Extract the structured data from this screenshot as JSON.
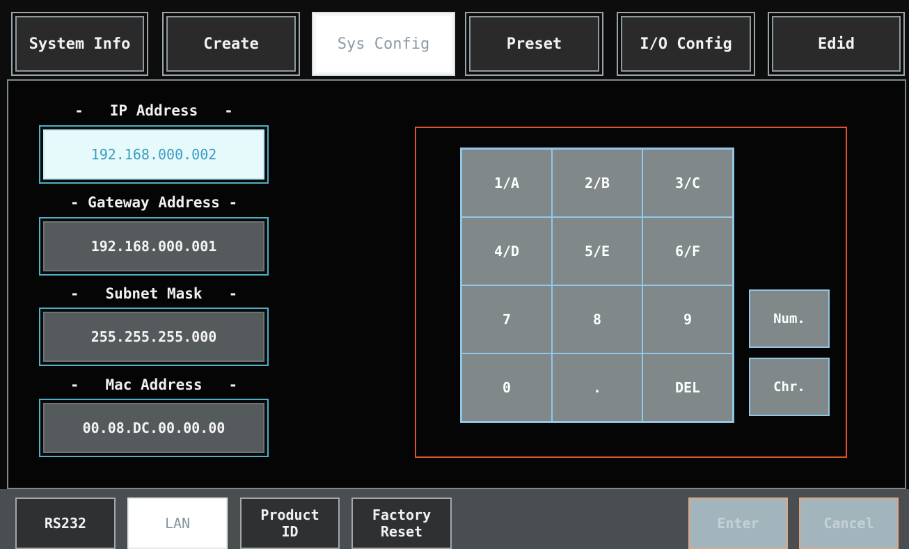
{
  "top_tabs": [
    {
      "label": "System Info"
    },
    {
      "label": "Create"
    },
    {
      "label": "Sys Config"
    },
    {
      "label": "Preset"
    },
    {
      "label": "I/O Config"
    },
    {
      "label": "Edid"
    }
  ],
  "network": {
    "ip_label": "-   IP Address   -",
    "ip_value": "192.168.000.002",
    "gateway_label": "- Gateway Address -",
    "gateway_value": "192.168.000.001",
    "subnet_label": "-   Subnet Mask   -",
    "subnet_value": "255.255.255.000",
    "mac_label": "-   Mac Address   -",
    "mac_value": "00.08.DC.00.00.00"
  },
  "keypad": {
    "keys": [
      "1/A",
      "2/B",
      "3/C",
      "4/D",
      "5/E",
      "6/F",
      "7",
      "8",
      "9",
      "0",
      ".",
      "DEL"
    ],
    "num_label": "Num.",
    "chr_label": "Chr."
  },
  "bottom_tabs": {
    "rs232": "RS232",
    "lan": "LAN",
    "product_id_line1": "Product",
    "product_id_line2": "ID",
    "factory_reset_line1": "Factory",
    "factory_reset_line2": "Reset",
    "enter": "Enter",
    "cancel": "Cancel"
  },
  "colors": {
    "field_border": "#4fb0c6",
    "keypad_frame": "#e0522c",
    "key_border": "#8fc6e6"
  }
}
